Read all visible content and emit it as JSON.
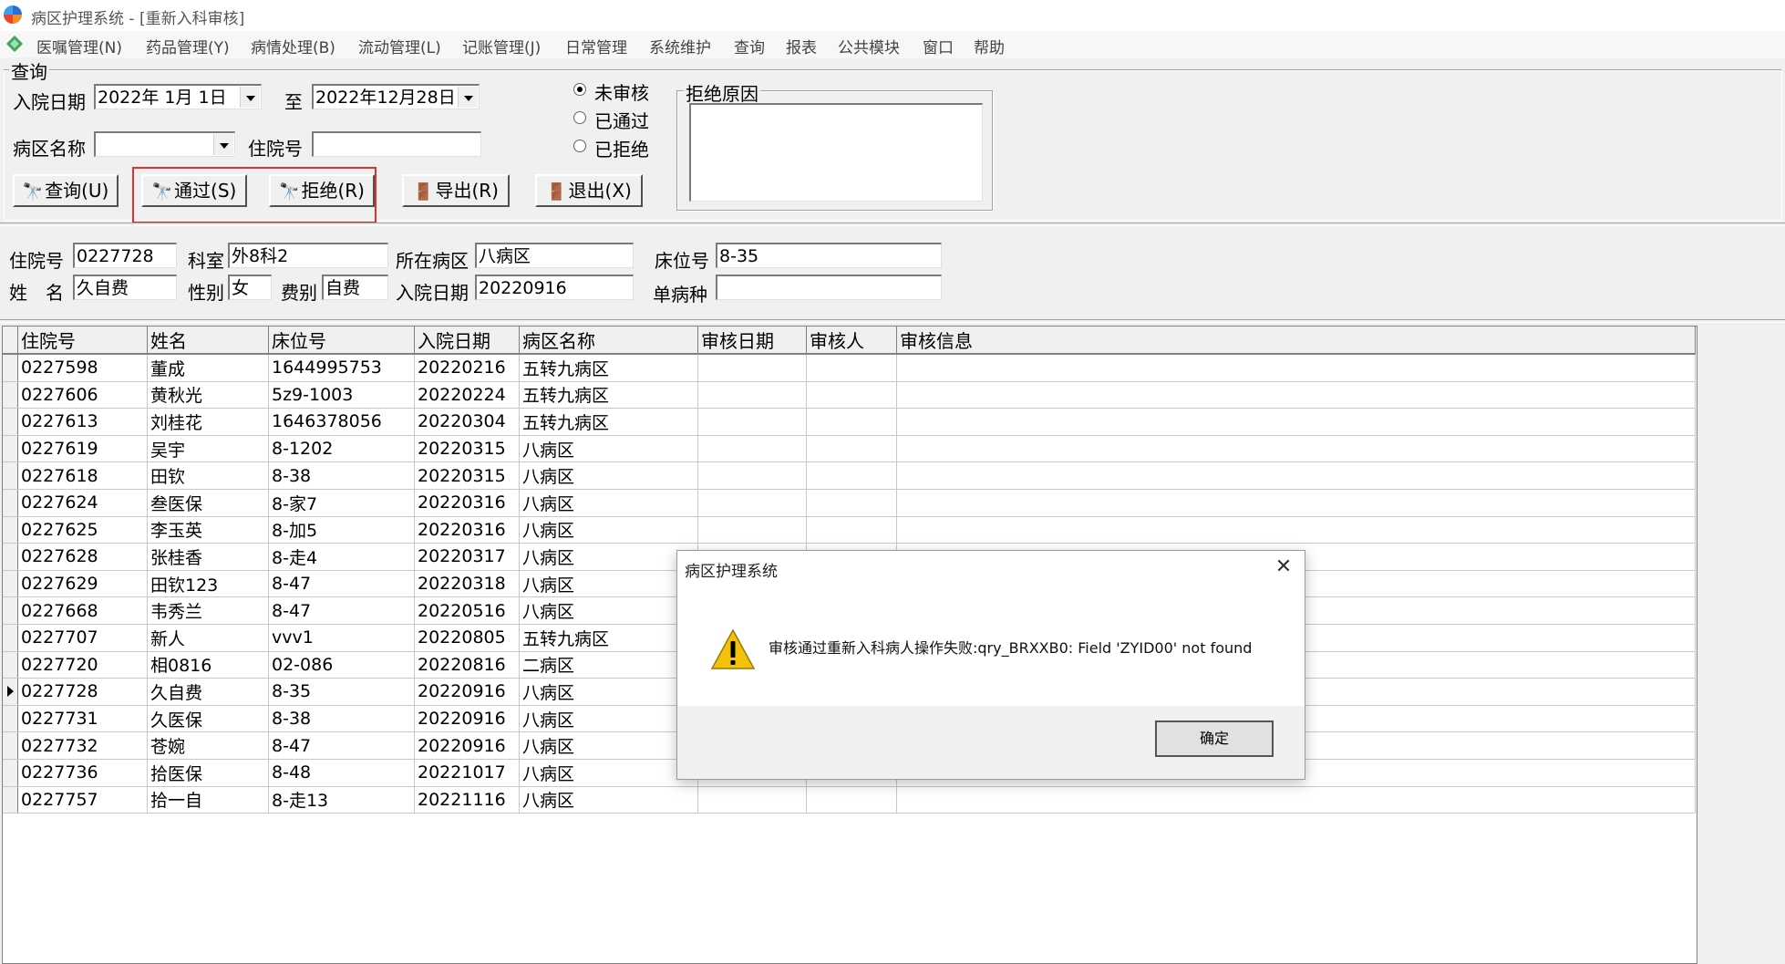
{
  "window": {
    "title": "病区护理系统 - [重新入科审核]"
  },
  "menu": [
    "医嘱管理(N)",
    "药品管理(Y)",
    "病情处理(B)",
    "流动管理(L)",
    "记账管理(J)",
    "日常管理",
    "系统维护",
    "查询",
    "报表",
    "公共模块",
    "窗口",
    "帮助"
  ],
  "query": {
    "legend": "查询",
    "admit_date_label": "入院日期",
    "date_from": "2022年 1月 1日",
    "to_label": "至",
    "date_to": "2022年12月28日",
    "ward_label": "病区名称",
    "ward_value": "",
    "inpatient_no_label": "住院号",
    "inpatient_no_value": "",
    "status_options": [
      "未审核",
      "已通过",
      "已拒绝"
    ],
    "status_selected": "未审核",
    "buttons": {
      "query": "查询(U)",
      "pass": "通过(S)",
      "reject": "拒绝(R)",
      "export": "导出(R)",
      "exit": "退出(X)"
    }
  },
  "reject_reason": {
    "legend": "拒绝原因",
    "value": ""
  },
  "detail": {
    "inpatient_no_label": "住院号",
    "inpatient_no": "0227728",
    "dept_label": "科室",
    "dept": "外8科2",
    "ward_label": "所在病区",
    "ward": "八病区",
    "bed_label": "床位号",
    "bed": "8-35",
    "name_label": "姓　名",
    "name": "久自费",
    "sex_label": "性别",
    "sex": "女",
    "fee_label": "费别",
    "fee": "自费",
    "admit_label": "入院日期",
    "admit": "20220916",
    "single_disease_label": "单病种",
    "single_disease": ""
  },
  "grid": {
    "columns": [
      "住院号",
      "姓名",
      "床位号",
      "入院日期",
      "病区名称",
      "审核日期",
      "审核人",
      "审核信息"
    ],
    "rows": [
      [
        "0227598",
        "董成",
        "1644995753",
        "20220216",
        "五转九病区",
        "",
        "",
        ""
      ],
      [
        "0227606",
        "黄秋光",
        "5z9-1003",
        "20220224",
        "五转九病区",
        "",
        "",
        ""
      ],
      [
        "0227613",
        "刘桂花",
        "1646378056",
        "20220304",
        "五转九病区",
        "",
        "",
        ""
      ],
      [
        "0227619",
        "吴宇",
        "8-1202",
        "20220315",
        "八病区",
        "",
        "",
        ""
      ],
      [
        "0227618",
        "田钦",
        "8-38",
        "20220315",
        "八病区",
        "",
        "",
        ""
      ],
      [
        "0227624",
        "叁医保",
        "8-家7",
        "20220316",
        "八病区",
        "",
        "",
        ""
      ],
      [
        "0227625",
        "李玉英",
        "8-加5",
        "20220316",
        "八病区",
        "",
        "",
        ""
      ],
      [
        "0227628",
        "张桂香",
        "8-走4",
        "20220317",
        "八病区",
        "",
        "",
        ""
      ],
      [
        "0227629",
        "田钦123",
        "8-47",
        "20220318",
        "八病区",
        "",
        "",
        ""
      ],
      [
        "0227668",
        "韦秀兰",
        "8-47",
        "20220516",
        "八病区",
        "",
        "",
        ""
      ],
      [
        "0227707",
        "新人",
        "vvv1",
        "20220805",
        "五转九病区",
        "",
        "",
        ""
      ],
      [
        "0227720",
        "相0816",
        "02-086",
        "20220816",
        "二病区",
        "",
        "",
        ""
      ],
      [
        "0227728",
        "久自费",
        "8-35",
        "20220916",
        "八病区",
        "",
        "",
        ""
      ],
      [
        "0227731",
        "久医保",
        "8-38",
        "20220916",
        "八病区",
        "",
        "",
        ""
      ],
      [
        "0227732",
        "苍婉",
        "8-47",
        "20220916",
        "八病区",
        "",
        "",
        ""
      ],
      [
        "0227736",
        "拾医保",
        "8-48",
        "20221017",
        "八病区",
        "",
        "",
        ""
      ],
      [
        "0227757",
        "拾一自",
        "8-走13",
        "20221116",
        "八病区",
        "",
        "",
        ""
      ]
    ],
    "current_row": 12
  },
  "dialog": {
    "title": "病区护理系统",
    "message": "审核通过重新入科病人操作失败:qry_BRXXB0: Field 'ZYID00' not found",
    "ok_label": "确定"
  }
}
